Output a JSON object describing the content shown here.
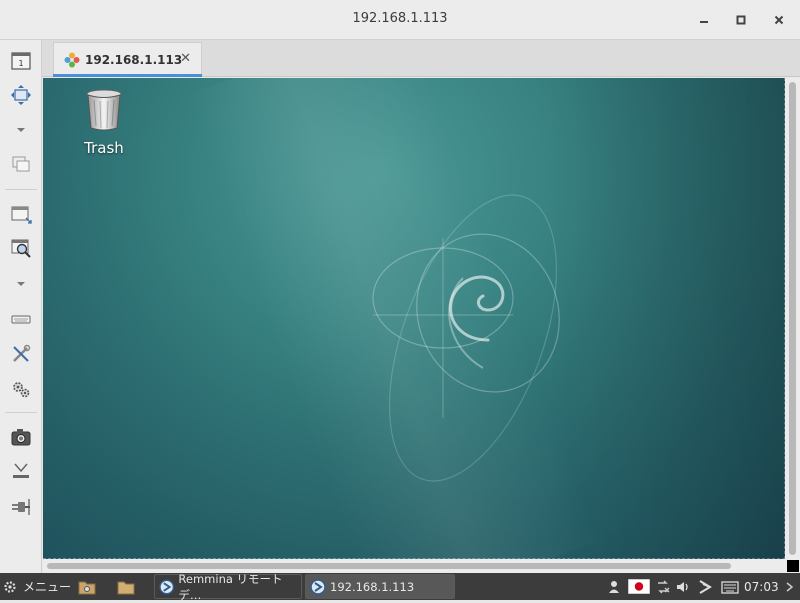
{
  "window": {
    "title": "192.168.1.113"
  },
  "toolbar_left": {
    "icons": [
      "screen-switch-icon",
      "fit-window-icon",
      "dropdown-icon",
      "multi-monitor-icon",
      "scaled-window-icon",
      "zoom-scale-icon",
      "dropdown-icon",
      "keyboard-icon",
      "tools-icon",
      "preferences-icon",
      "screenshot-icon",
      "minimize-icon",
      "disconnect-icon"
    ]
  },
  "tab": {
    "label": "192.168.1.113",
    "close": "✕"
  },
  "desktop": {
    "trash_label": "Trash",
    "colors": {
      "background": "#2d6f72",
      "accent": "#4b9896"
    }
  },
  "taskbar": {
    "menu_label": "メニュー",
    "tasks": [
      {
        "label": "Remmina リモートデ…",
        "active": false
      },
      {
        "label": "192.168.1.113",
        "active": true
      }
    ],
    "clock": "07:03",
    "tray_icons": [
      "user-icon",
      "japan-flag-icon",
      "network-icon",
      "volume-icon",
      "remmina-tray-icon",
      "keyboard-layout-icon"
    ]
  }
}
